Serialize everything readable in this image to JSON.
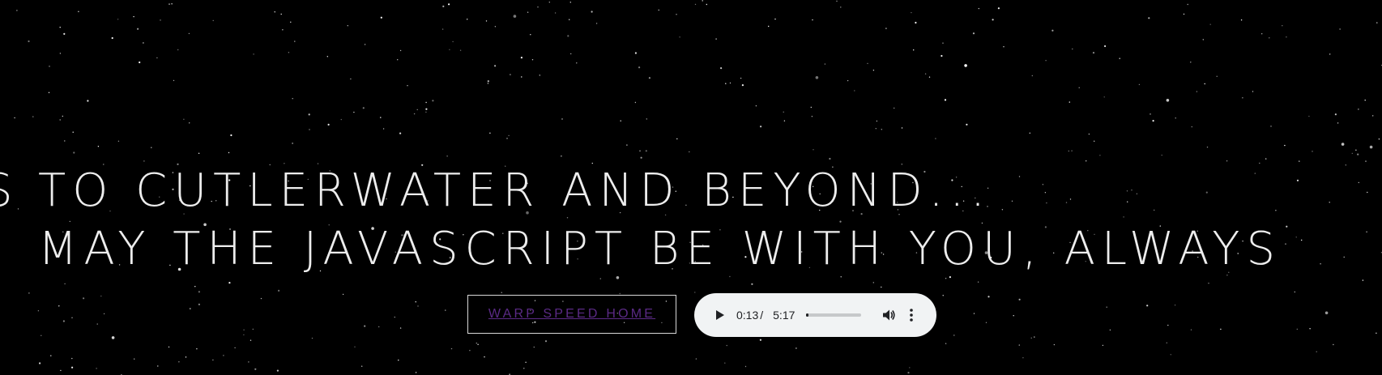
{
  "hero": {
    "line1": "TO CUTLERWATER AND BEYOND...",
    "line2": "MAY THE JAVASCRIPT BE WITH YOU, ALWAYS",
    "cutoff_char_line1": "S",
    "cutoff_char_line2": "!"
  },
  "home_link": {
    "label": "WARP SPEED HOME"
  },
  "audio": {
    "current_time": "0:13",
    "separator": "/",
    "total_time": "5:17",
    "progress_fraction": 0.041,
    "play_icon": "play-icon",
    "volume_icon": "volume-icon",
    "more_icon": "more-vert-icon"
  },
  "colors": {
    "background": "#000000",
    "text": "#ededed",
    "link": "#5b2a86",
    "player_bg": "#f1f3f4"
  }
}
